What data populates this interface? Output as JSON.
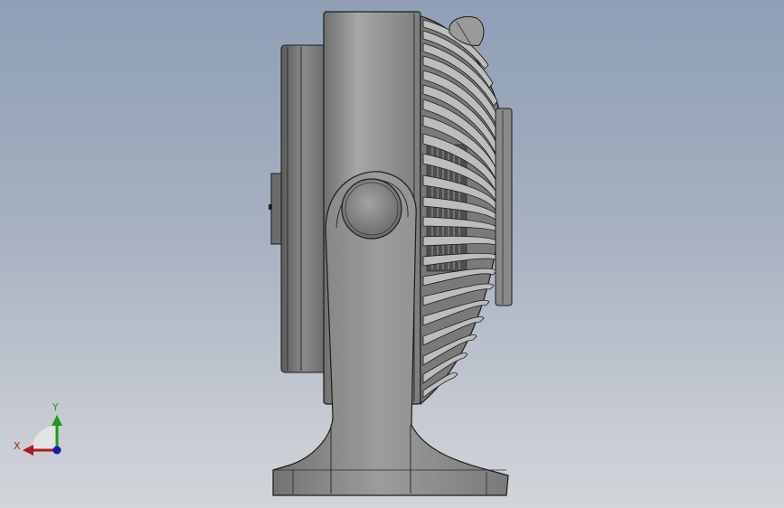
{
  "triad": {
    "x_label": "X",
    "y_label": "Y",
    "x_color": "#b11a1a",
    "y_color": "#1a9a1a",
    "z_color": "#1a1ab1"
  },
  "model": {
    "name": "desk fan",
    "view": "side",
    "body_color": "#8e8e8e",
    "edge_color": "#1c1c1c"
  },
  "viewport": {
    "background_top": "#8f9fb6",
    "background_bottom": "#d2d5da"
  }
}
